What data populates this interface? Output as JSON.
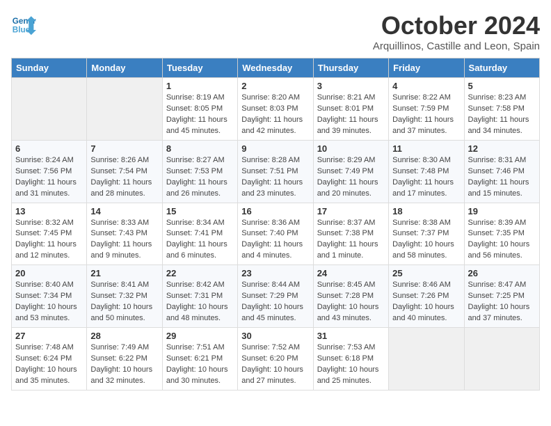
{
  "header": {
    "logo_line1": "General",
    "logo_line2": "Blue",
    "month": "October 2024",
    "location": "Arquillinos, Castille and Leon, Spain"
  },
  "weekdays": [
    "Sunday",
    "Monday",
    "Tuesday",
    "Wednesday",
    "Thursday",
    "Friday",
    "Saturday"
  ],
  "weeks": [
    [
      {
        "day": "",
        "info": ""
      },
      {
        "day": "",
        "info": ""
      },
      {
        "day": "1",
        "info": "Sunrise: 8:19 AM\nSunset: 8:05 PM\nDaylight: 11 hours\nand 45 minutes."
      },
      {
        "day": "2",
        "info": "Sunrise: 8:20 AM\nSunset: 8:03 PM\nDaylight: 11 hours\nand 42 minutes."
      },
      {
        "day": "3",
        "info": "Sunrise: 8:21 AM\nSunset: 8:01 PM\nDaylight: 11 hours\nand 39 minutes."
      },
      {
        "day": "4",
        "info": "Sunrise: 8:22 AM\nSunset: 7:59 PM\nDaylight: 11 hours\nand 37 minutes."
      },
      {
        "day": "5",
        "info": "Sunrise: 8:23 AM\nSunset: 7:58 PM\nDaylight: 11 hours\nand 34 minutes."
      }
    ],
    [
      {
        "day": "6",
        "info": "Sunrise: 8:24 AM\nSunset: 7:56 PM\nDaylight: 11 hours\nand 31 minutes."
      },
      {
        "day": "7",
        "info": "Sunrise: 8:26 AM\nSunset: 7:54 PM\nDaylight: 11 hours\nand 28 minutes."
      },
      {
        "day": "8",
        "info": "Sunrise: 8:27 AM\nSunset: 7:53 PM\nDaylight: 11 hours\nand 26 minutes."
      },
      {
        "day": "9",
        "info": "Sunrise: 8:28 AM\nSunset: 7:51 PM\nDaylight: 11 hours\nand 23 minutes."
      },
      {
        "day": "10",
        "info": "Sunrise: 8:29 AM\nSunset: 7:49 PM\nDaylight: 11 hours\nand 20 minutes."
      },
      {
        "day": "11",
        "info": "Sunrise: 8:30 AM\nSunset: 7:48 PM\nDaylight: 11 hours\nand 17 minutes."
      },
      {
        "day": "12",
        "info": "Sunrise: 8:31 AM\nSunset: 7:46 PM\nDaylight: 11 hours\nand 15 minutes."
      }
    ],
    [
      {
        "day": "13",
        "info": "Sunrise: 8:32 AM\nSunset: 7:45 PM\nDaylight: 11 hours\nand 12 minutes."
      },
      {
        "day": "14",
        "info": "Sunrise: 8:33 AM\nSunset: 7:43 PM\nDaylight: 11 hours\nand 9 minutes."
      },
      {
        "day": "15",
        "info": "Sunrise: 8:34 AM\nSunset: 7:41 PM\nDaylight: 11 hours\nand 6 minutes."
      },
      {
        "day": "16",
        "info": "Sunrise: 8:36 AM\nSunset: 7:40 PM\nDaylight: 11 hours\nand 4 minutes."
      },
      {
        "day": "17",
        "info": "Sunrise: 8:37 AM\nSunset: 7:38 PM\nDaylight: 11 hours\nand 1 minute."
      },
      {
        "day": "18",
        "info": "Sunrise: 8:38 AM\nSunset: 7:37 PM\nDaylight: 10 hours\nand 58 minutes."
      },
      {
        "day": "19",
        "info": "Sunrise: 8:39 AM\nSunset: 7:35 PM\nDaylight: 10 hours\nand 56 minutes."
      }
    ],
    [
      {
        "day": "20",
        "info": "Sunrise: 8:40 AM\nSunset: 7:34 PM\nDaylight: 10 hours\nand 53 minutes."
      },
      {
        "day": "21",
        "info": "Sunrise: 8:41 AM\nSunset: 7:32 PM\nDaylight: 10 hours\nand 50 minutes."
      },
      {
        "day": "22",
        "info": "Sunrise: 8:42 AM\nSunset: 7:31 PM\nDaylight: 10 hours\nand 48 minutes."
      },
      {
        "day": "23",
        "info": "Sunrise: 8:44 AM\nSunset: 7:29 PM\nDaylight: 10 hours\nand 45 minutes."
      },
      {
        "day": "24",
        "info": "Sunrise: 8:45 AM\nSunset: 7:28 PM\nDaylight: 10 hours\nand 43 minutes."
      },
      {
        "day": "25",
        "info": "Sunrise: 8:46 AM\nSunset: 7:26 PM\nDaylight: 10 hours\nand 40 minutes."
      },
      {
        "day": "26",
        "info": "Sunrise: 8:47 AM\nSunset: 7:25 PM\nDaylight: 10 hours\nand 37 minutes."
      }
    ],
    [
      {
        "day": "27",
        "info": "Sunrise: 7:48 AM\nSunset: 6:24 PM\nDaylight: 10 hours\nand 35 minutes."
      },
      {
        "day": "28",
        "info": "Sunrise: 7:49 AM\nSunset: 6:22 PM\nDaylight: 10 hours\nand 32 minutes."
      },
      {
        "day": "29",
        "info": "Sunrise: 7:51 AM\nSunset: 6:21 PM\nDaylight: 10 hours\nand 30 minutes."
      },
      {
        "day": "30",
        "info": "Sunrise: 7:52 AM\nSunset: 6:20 PM\nDaylight: 10 hours\nand 27 minutes."
      },
      {
        "day": "31",
        "info": "Sunrise: 7:53 AM\nSunset: 6:18 PM\nDaylight: 10 hours\nand 25 minutes."
      },
      {
        "day": "",
        "info": ""
      },
      {
        "day": "",
        "info": ""
      }
    ]
  ]
}
